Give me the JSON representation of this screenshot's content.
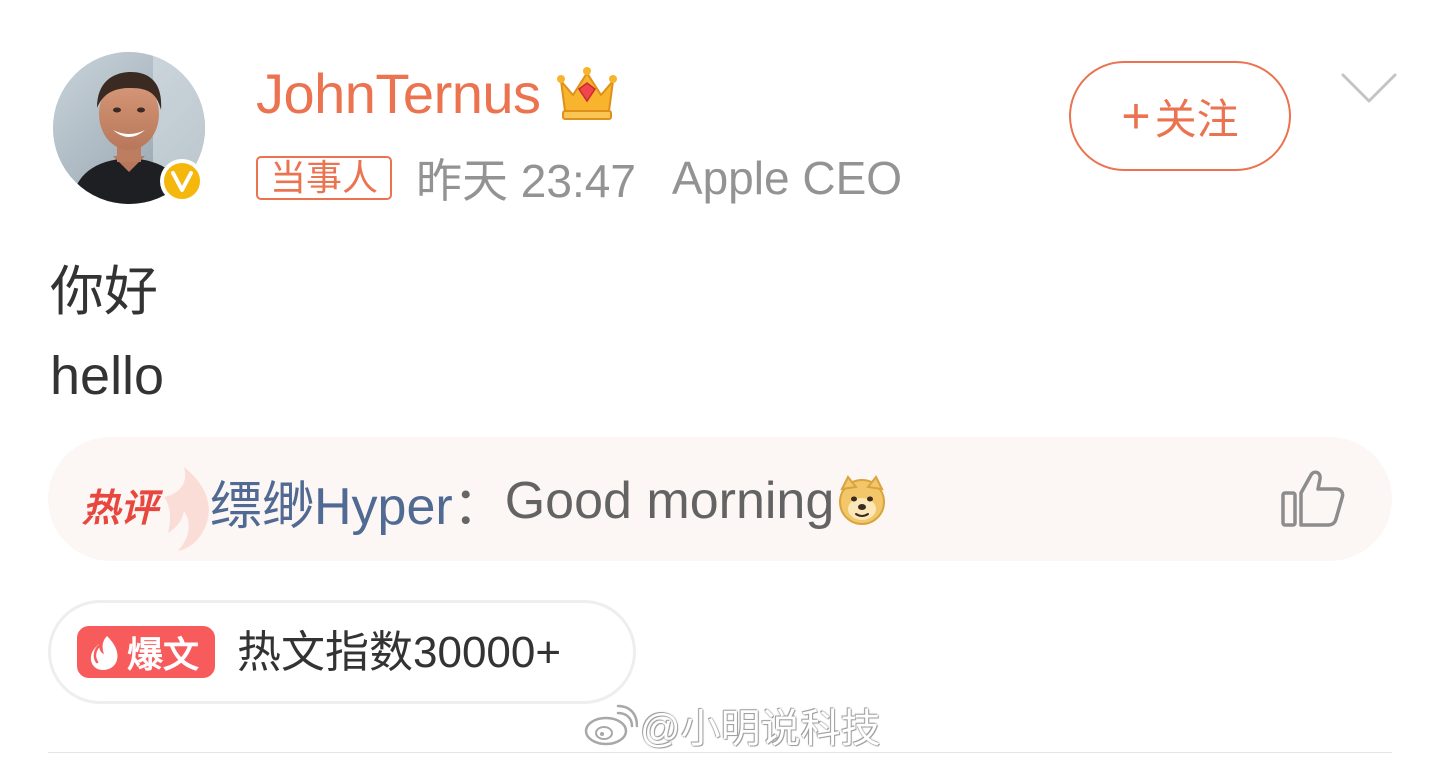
{
  "post": {
    "author": {
      "username": "JohnTernus",
      "avatar_icon": "avatar-photo",
      "verified_badge_icon": "verified-v-icon",
      "verified_badge_letter": "V",
      "membership_icon": "vip-crown-icon"
    },
    "role_tag": "当事人",
    "timestamp": "昨天 23:47",
    "source": "Apple CEO",
    "follow_button": {
      "plus": "+",
      "label": "关注"
    },
    "more_icon": "chevron-down-icon",
    "content_lines": [
      "你好",
      "hello"
    ]
  },
  "hot_comment": {
    "label": "热评",
    "label_icon": "flame-icon",
    "commenter": "缥缈Hyper",
    "separator": "：",
    "text": "Good morning",
    "emoji_icon": "doge-icon",
    "like_icon": "thumbs-up-icon"
  },
  "trend": {
    "badge_icon": "fire-icon",
    "badge_text": "爆文",
    "text": "热文指数30000+"
  },
  "watermark": {
    "logo_icon": "weibo-logo-icon",
    "text": "@小明说科技"
  },
  "colors": {
    "accent": "#eb7350",
    "verified": "#f5b70b",
    "commenter_name": "#506a94",
    "hot_label": "#e8473f",
    "trend_badge": "#f85b5b",
    "muted_text": "#939393"
  }
}
